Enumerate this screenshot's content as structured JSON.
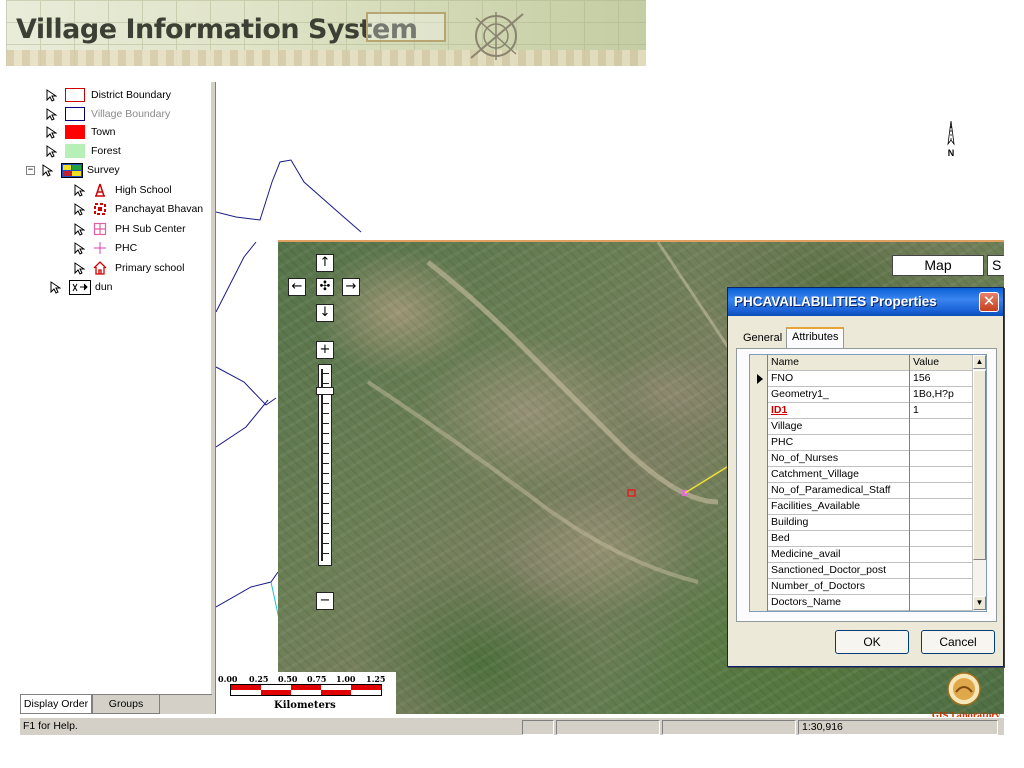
{
  "banner": {
    "title": "Village Information System"
  },
  "toc": {
    "layers": [
      {
        "label": "District Boundary",
        "color": "#ffffff",
        "border": "#cc0000"
      },
      {
        "label": "Village Boundary",
        "color": "#ffffff",
        "border": "#000080"
      },
      {
        "label": "Town",
        "color": "#ff0000",
        "border": "#ff0000"
      },
      {
        "label": "Forest",
        "color": "#b6f0b6",
        "border": "#b6f0b6"
      },
      {
        "label": "Survey"
      }
    ],
    "survey_items": [
      {
        "label": "High School",
        "icon": "school-icon"
      },
      {
        "label": "Panchayat Bhavan",
        "icon": "panchayat-icon"
      },
      {
        "label": "PH Sub Center",
        "icon": "ph-subcenter-icon"
      },
      {
        "label": "PHC",
        "icon": "phc-cross-icon"
      },
      {
        "label": "Primary school",
        "icon": "primary-school-icon"
      }
    ],
    "dun_label": "dun",
    "collapse_symbol": "−",
    "tabs": {
      "display_order": "Display Order",
      "groups": "Groups"
    }
  },
  "statusbar": {
    "help_text": "F1 for Help.",
    "scale": "1:30,916"
  },
  "map": {
    "north_label": "N",
    "nav": {
      "up": "↑",
      "down": "↓",
      "left": "←",
      "right": "→",
      "center": "✣",
      "zoom_in": "+",
      "zoom_out": "−"
    },
    "map_button": "Map",
    "satellite_button": "S"
  },
  "scalebar": {
    "labels": [
      "0.00",
      "0.25",
      "0.50",
      "0.75",
      "1.00",
      "1.25"
    ],
    "unit": "Kilometers"
  },
  "logo": {
    "text": "GIS Laboratory"
  },
  "dialog": {
    "title": "PHCAVAILABILITIES Properties",
    "close": "✕",
    "tabs": {
      "general": "General",
      "attributes": "Attributes"
    },
    "columns": {
      "name": "Name",
      "value": "Value"
    },
    "rows": [
      {
        "name": "FNO",
        "value": "156"
      },
      {
        "name": "Geometry1_",
        "value": "1Bo,H?p"
      },
      {
        "name": "ID1",
        "value": "1"
      },
      {
        "name": "Village",
        "value": ""
      },
      {
        "name": "PHC",
        "value": ""
      },
      {
        "name": "No_of_Nurses",
        "value": ""
      },
      {
        "name": "Catchment_Village",
        "value": ""
      },
      {
        "name": "No_of_Paramedical_Staff",
        "value": ""
      },
      {
        "name": "Facilities_Available",
        "value": ""
      },
      {
        "name": "Building",
        "value": ""
      },
      {
        "name": "Bed",
        "value": ""
      },
      {
        "name": "Medicine_avail",
        "value": ""
      },
      {
        "name": "Sanctioned_Doctor_post",
        "value": ""
      },
      {
        "name": "Number_of_Doctors",
        "value": ""
      },
      {
        "name": "Doctors_Name",
        "value": ""
      }
    ],
    "scroll_up": "▲",
    "scroll_down": "▼",
    "ok": "OK",
    "cancel": "Cancel"
  },
  "colors": {
    "titlebar": "#0a5fd6",
    "scale_red": "#e00000",
    "village_boundary": "#000080",
    "district_boundary": "#cc0000",
    "forest": "#b6f0b6",
    "highlight_field": "#cc0000"
  }
}
